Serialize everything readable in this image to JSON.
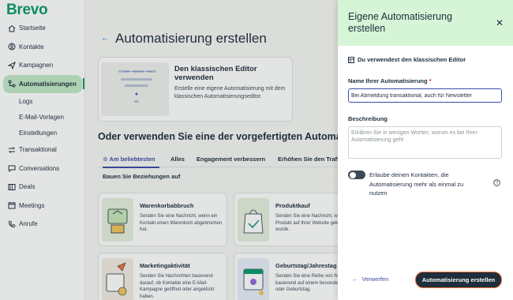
{
  "app": {
    "logo": "Brevo",
    "brand_color": "#0b996e"
  },
  "sidebar": {
    "items": [
      {
        "label": "Startseite",
        "icon": "home-icon"
      },
      {
        "label": "Kontakte",
        "icon": "contacts-icon"
      },
      {
        "label": "Kampagnen",
        "icon": "send-icon"
      },
      {
        "label": "Automatisierungen",
        "icon": "automation-icon",
        "active": true
      }
    ],
    "sub_items": [
      "Logs",
      "E-Mail-Vorlagen",
      "Einstellungen"
    ],
    "items_after": [
      {
        "label": "Transaktional",
        "icon": "transfer-icon"
      },
      {
        "label": "Conversations",
        "icon": "chat-icon"
      },
      {
        "label": "Deals",
        "icon": "deals-icon"
      },
      {
        "label": "Meetings",
        "icon": "calendar-icon"
      },
      {
        "label": "Anrufe",
        "icon": "phone-icon"
      }
    ]
  },
  "main": {
    "title": "Automatisierung erstellen",
    "classic": {
      "title": "Den klassischen Editor verwenden",
      "description": "Erstelle eine eigene Automatisierung mit dem klassischen Automatisierungseditor."
    },
    "section_title": "Oder verwenden Sie eine der vorgefertigten Automatisierungen",
    "tabs": [
      "Am beliebtesten",
      "Alles",
      "Engagement verbessern",
      "Erhöhen Sie den Traffic"
    ],
    "tab_row2": "Bauen Sie Beziehungen auf",
    "templates": [
      {
        "title": "Warenkorbabbruch",
        "description": "Senden Sie eine Nachricht, wenn ein Kontakt einen Warenkorb abgebrochen hat."
      },
      {
        "title": "Produktkauf",
        "description": "Senden Sie eine Nachricht, wenn ein Produkt auf Ihrer Website gekauft wurde."
      },
      {
        "title": "Marketingaktivität",
        "description": "Senden Sie Nachrichten basierend darauf, ob Kontakte eine E-Mail-Kampagne geöffnet oder angeklickt haben."
      },
      {
        "title": "Geburtstag/Jahrestag",
        "description": "Senden Sie eine Reihe von Nachrichten basierend auf einem besonderen Anlass oder Geburtstag."
      }
    ]
  },
  "panel": {
    "title": "Eigene Automatisierung erstellen",
    "editor_note": "Du verwendest den klassischen Editor",
    "name_label": "Name Ihrer Automatisierung",
    "required_mark": "*",
    "name_value": "Bei Abmeldung transaktional, auch für Newsletter",
    "description_label": "Beschreibung",
    "description_placeholder": "Erklären Sie in wenigen Worten, worum es bei Ihrer Automatisierung geht",
    "toggle_label": "Erlaube deinen Kontakten, die Automatisierung mehr als einmal zu nutzen",
    "toggle_on": false,
    "cancel_label": "Verwerfen",
    "create_label": "Automatisierung erstellen"
  }
}
